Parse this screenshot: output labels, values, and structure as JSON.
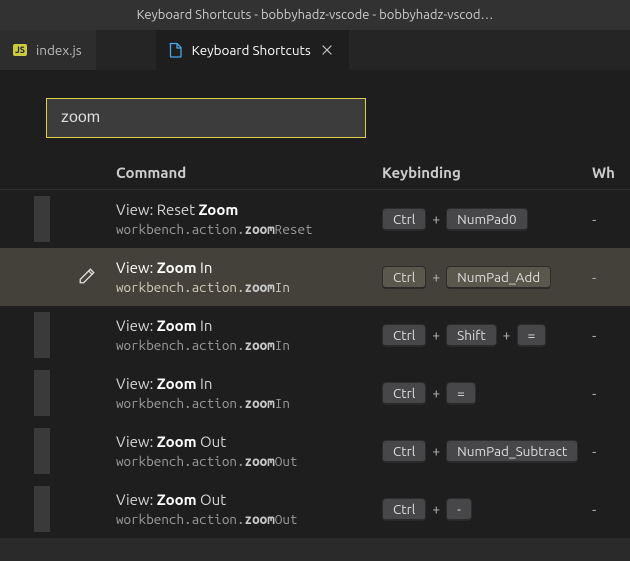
{
  "window": {
    "title": "Keyboard Shortcuts - bobbyhadz-vscode - bobbyhadz-vscod…"
  },
  "tabs": [
    {
      "label": "index.js",
      "icon": "js",
      "active": false,
      "closable": false
    },
    {
      "label": "Keyboard Shortcuts",
      "icon": "file",
      "active": true,
      "closable": true
    }
  ],
  "search": {
    "value": "zoom"
  },
  "columns": {
    "command": "Command",
    "keybinding": "Keybinding",
    "when": "Wh"
  },
  "rows": [
    {
      "title_pre": "View: Reset ",
      "title_hl": "Zoom",
      "title_post": "",
      "id_pre": "workbench.action.",
      "id_hl": "zoom",
      "id_post": "Reset",
      "keys": [
        "Ctrl",
        "NumPad0"
      ],
      "when": "-",
      "selected": false
    },
    {
      "title_pre": "View: ",
      "title_hl": "Zoom",
      "title_post": " In",
      "id_pre": "workbench.action.",
      "id_hl": "zoom",
      "id_post": "In",
      "keys": [
        "Ctrl",
        "NumPad_Add"
      ],
      "when": "-",
      "selected": true
    },
    {
      "title_pre": "View: ",
      "title_hl": "Zoom",
      "title_post": " In",
      "id_pre": "workbench.action.",
      "id_hl": "zoom",
      "id_post": "In",
      "keys": [
        "Ctrl",
        "Shift",
        "="
      ],
      "when": "-",
      "selected": false
    },
    {
      "title_pre": "View: ",
      "title_hl": "Zoom",
      "title_post": " In",
      "id_pre": "workbench.action.",
      "id_hl": "zoom",
      "id_post": "In",
      "keys": [
        "Ctrl",
        "="
      ],
      "when": "-",
      "selected": false
    },
    {
      "title_pre": "View: ",
      "title_hl": "Zoom",
      "title_post": " Out",
      "id_pre": "workbench.action.",
      "id_hl": "zoom",
      "id_post": "Out",
      "keys": [
        "Ctrl",
        "NumPad_Subtract"
      ],
      "when": "-",
      "selected": false
    },
    {
      "title_pre": "View: ",
      "title_hl": "Zoom",
      "title_post": " Out",
      "id_pre": "workbench.action.",
      "id_hl": "zoom",
      "id_post": "Out",
      "keys": [
        "Ctrl",
        "-"
      ],
      "when": "-",
      "selected": false
    }
  ]
}
